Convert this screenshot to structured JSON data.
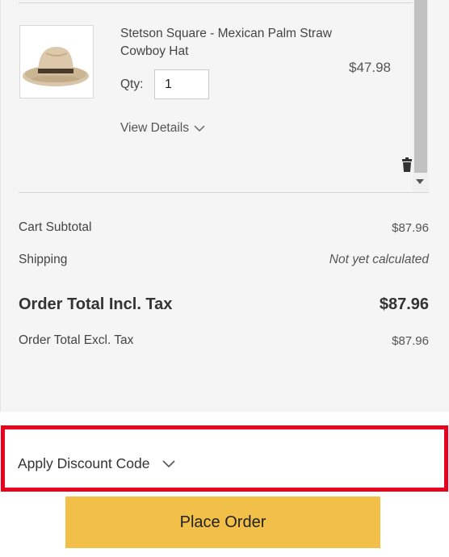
{
  "cart": {
    "item": {
      "name": "Stetson Square - Mexican Palm Straw Cowboy Hat",
      "image_icon": "cowboy-hat-image",
      "qty_label": "Qty:",
      "qty_value": "1",
      "price": "$47.98",
      "view_details_label": "View Details"
    }
  },
  "totals": {
    "subtotal_label": "Cart Subtotal",
    "subtotal_value": "$87.96",
    "shipping_label": "Shipping",
    "shipping_value": "Not yet calculated",
    "grand_label": "Order Total Incl. Tax",
    "grand_value": "$87.96",
    "excl_label": "Order Total Excl. Tax",
    "excl_value": "$87.96"
  },
  "discount": {
    "label": "Apply Discount Code",
    "highlight_color": "#e8001c"
  },
  "actions": {
    "place_order_label": "Place Order",
    "button_color": "#f2bf48"
  }
}
